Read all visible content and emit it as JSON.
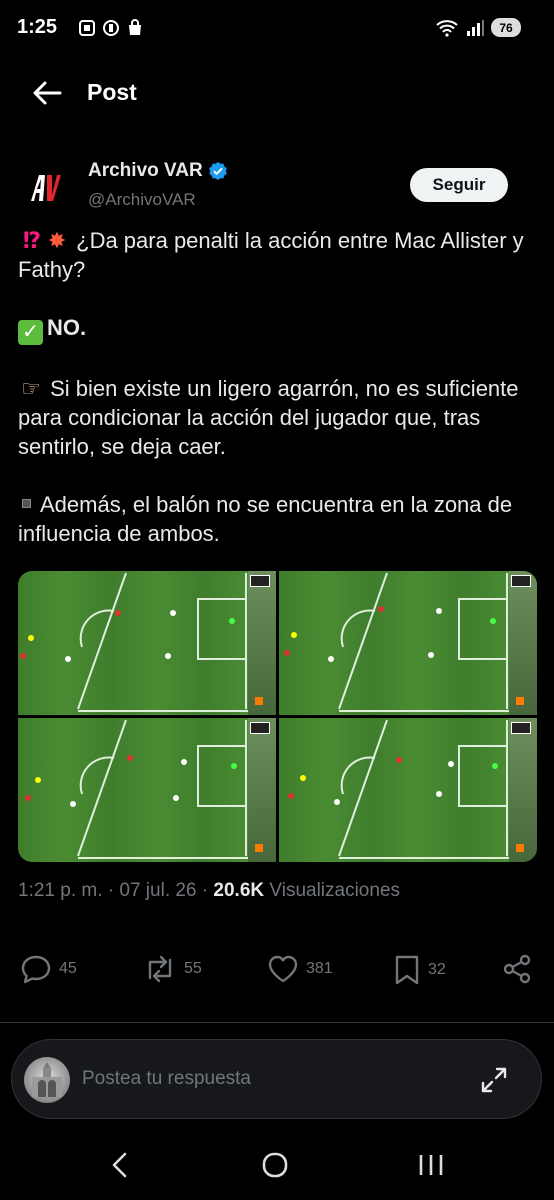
{
  "status_bar": {
    "time": "1:25",
    "battery": "76"
  },
  "header": {
    "title": "Post"
  },
  "author": {
    "name": "Archivo VAR",
    "handle": "@ArchivoVAR",
    "avatar_text": "AV",
    "follow_label": "Seguir"
  },
  "tweet": {
    "line1": "¿Da para penalti la acción entre Mac Allister y Fathy?",
    "line2": "NO.",
    "line3": "Si bien existe un ligero agarrón, no es suficiente para condicionar la acción del jugador que, tras sentirlo, se deja caer.",
    "line4": "Además, el balón no se encuentra en la zona de influencia de ambos."
  },
  "meta": {
    "time": "1:21 p. m.",
    "date": "07 jul. 26",
    "views_count": "20.6K",
    "views_label": "Visualizaciones"
  },
  "actions": {
    "replies": "45",
    "reposts": "55",
    "likes": "381",
    "bookmarks": "32"
  },
  "reply": {
    "placeholder": "Postea tu respuesta"
  },
  "icons": {
    "back": "arrow-left-icon",
    "verified": "verified-badge-icon",
    "reply": "speech-bubble-icon",
    "repost": "repost-icon",
    "like": "heart-icon",
    "bookmark": "bookmark-icon",
    "share": "share-icon",
    "expand": "expand-icon"
  },
  "colors": {
    "background": "#000000",
    "text": "#e7e9ea",
    "muted": "#71767b",
    "verified": "#1d9bf0",
    "follow_bg": "#eff3f4"
  }
}
